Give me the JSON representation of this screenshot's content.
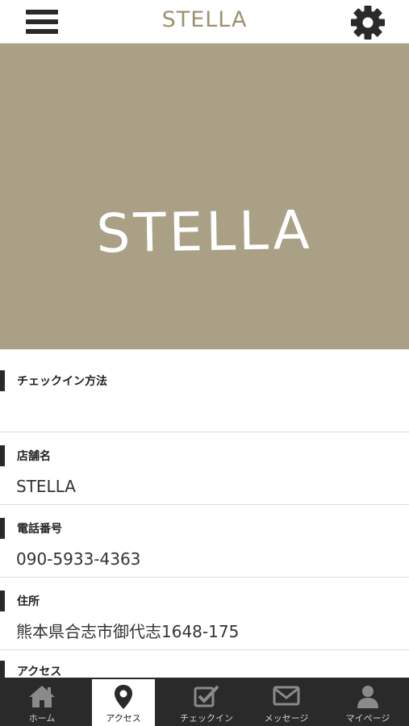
{
  "header": {
    "title": "STELLA",
    "menu_icon": "hamburger-menu-icon",
    "settings_icon": "gear-icon"
  },
  "hero": {
    "title": "STELLA",
    "background_color": "#aaa086"
  },
  "info": {
    "rows": [
      {
        "label": "チェックイン方法",
        "value": ""
      },
      {
        "label": "店舗名",
        "value": "STELLA"
      },
      {
        "label": "電話番号",
        "value": "090-5933-4363"
      },
      {
        "label": "住所",
        "value": "熊本県合志市御代志1648-175"
      },
      {
        "label": "アクセス",
        "value": ""
      }
    ]
  },
  "tabbar": {
    "active": "アクセス",
    "tabs": [
      {
        "label": "ホーム",
        "icon": "home-icon"
      },
      {
        "label": "アクセス",
        "icon": "map-pin-icon"
      },
      {
        "label": "チェックイン",
        "icon": "checkbox-icon"
      },
      {
        "label": "メッセージ",
        "icon": "envelope-icon"
      },
      {
        "label": "マイページ",
        "icon": "user-icon"
      }
    ]
  },
  "colors": {
    "accent": "#9e916f",
    "tabbar_bg": "#2a2a2a"
  }
}
